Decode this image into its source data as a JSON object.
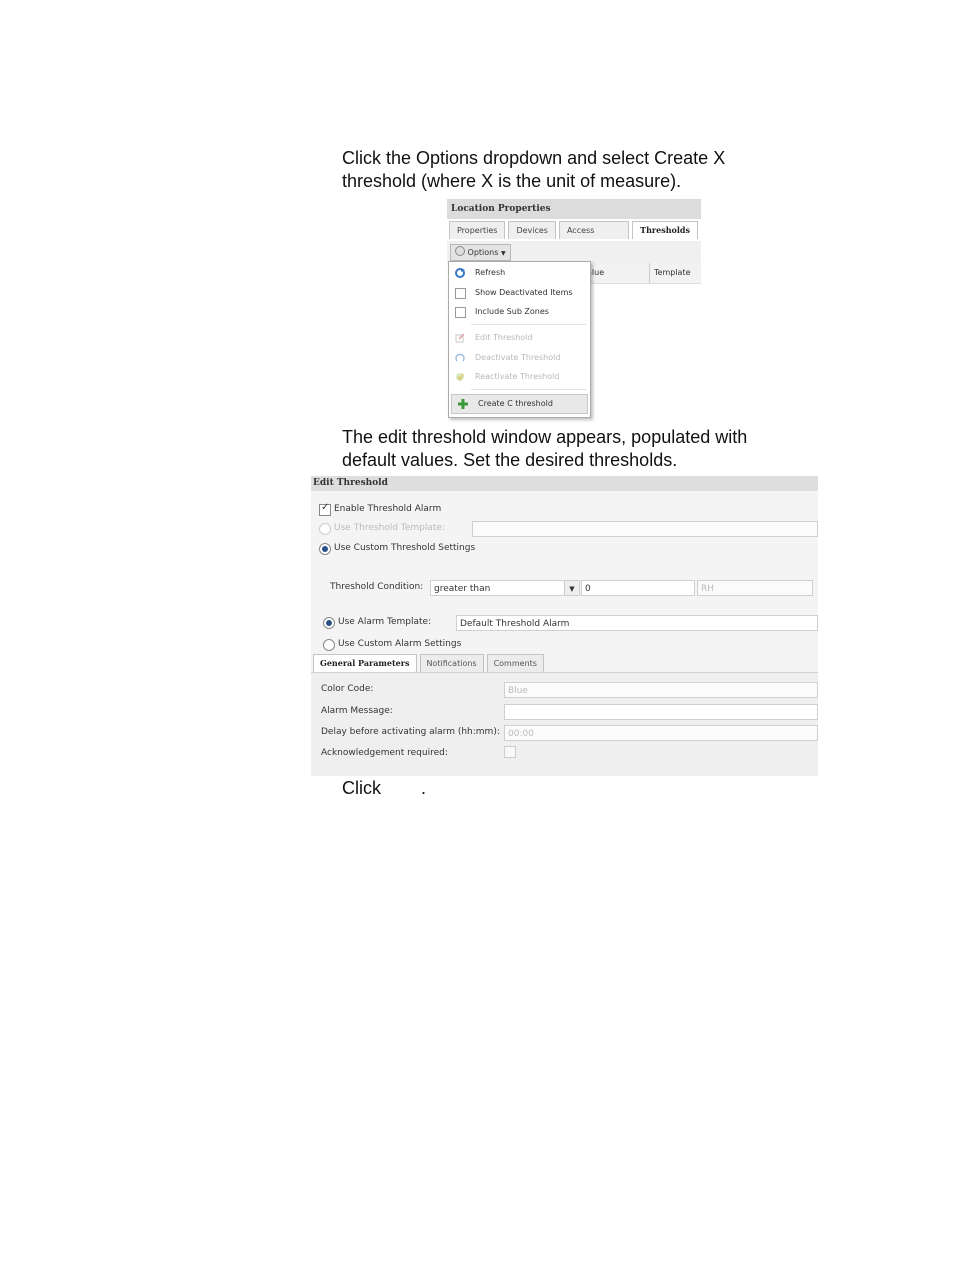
{
  "instructions": {
    "step1_line1": "Click the Options dropdown and select Create X",
    "step1_line2": "threshold (where X is the unit of measure).",
    "step2_line1": "The edit threshold window appears, populated with",
    "step2_line2": "default values. Set the desired thresholds.",
    "step3_prefix": "Click",
    "step3_suffix": "."
  },
  "location_properties": {
    "title": "Location Properties",
    "tabs": [
      "Properties",
      "Devices",
      "Access Control",
      "Thresholds"
    ],
    "active_tab": "Thresholds",
    "options_label": "Options",
    "columns": [
      "alue",
      "Template"
    ],
    "menu": [
      {
        "label": "Refresh",
        "icon": "refresh-icon",
        "enabled": true
      },
      {
        "label": "Show Deactivated Items",
        "icon": "checkbox-icon",
        "enabled": true
      },
      {
        "label": "Include Sub Zones",
        "icon": "checkbox-icon",
        "enabled": true
      },
      {
        "label": "Edit Threshold",
        "icon": "edit-icon",
        "enabled": false
      },
      {
        "label": "Deactivate Threshold",
        "icon": "deactivate-icon",
        "enabled": false
      },
      {
        "label": "Reactivate Threshold",
        "icon": "reactivate-icon",
        "enabled": false
      },
      {
        "label": "Create C threshold",
        "icon": "add-icon",
        "enabled": true
      }
    ]
  },
  "edit_threshold": {
    "title": "Edit Threshold",
    "enable_alarm_label": "Enable Threshold Alarm",
    "enable_alarm_checked": true,
    "use_template_label": "Use Threshold Template:",
    "use_custom_label": "Use Custom Threshold Settings",
    "condition_label": "Threshold Condition:",
    "condition_value": "greater than",
    "condition_number": "0",
    "condition_unit": "RH",
    "use_alarm_template_label": "Use Alarm Template:",
    "alarm_template_value": "Default Threshold Alarm",
    "use_custom_alarm_label": "Use Custom Alarm Settings",
    "tabs": [
      "General Parameters",
      "Notifications",
      "Comments"
    ],
    "active_tab": "General Parameters",
    "fields": [
      {
        "label": "Color Code:",
        "value": "Blue"
      },
      {
        "label": "Alarm Message:",
        "value": ""
      },
      {
        "label": "Delay before activating alarm (hh:mm):",
        "value": "00:00"
      },
      {
        "label": "Acknowledgement required:",
        "value": ""
      }
    ],
    "accent_color": "#2a4f8a"
  }
}
